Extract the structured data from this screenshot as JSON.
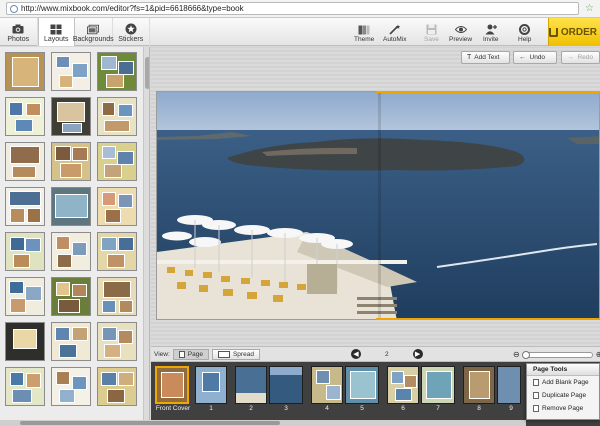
{
  "browser": {
    "url": "http://www.mixbook.com/editor?fs=1&pid=6618666&type=book"
  },
  "left_tabs": [
    {
      "label": "Photos",
      "icon": "camera-icon"
    },
    {
      "label": "Layouts",
      "icon": "grid-icon"
    },
    {
      "label": "Backgrounds",
      "icon": "background-icon"
    },
    {
      "label": "Stickers",
      "icon": "star-icon"
    }
  ],
  "toolbar": {
    "theme": "Theme",
    "automix": "AutoMix",
    "save": "Save",
    "preview": "Preview",
    "invite": "Invite",
    "help": "Help",
    "order": "ORDER"
  },
  "actions": {
    "add_text": "Add Text",
    "undo": "Undo",
    "redo": "Redo"
  },
  "view_bar": {
    "view_label": "View:",
    "page_btn": "Page",
    "spread_btn": "Spread",
    "current_page": "2"
  },
  "filmstrip": {
    "labels": [
      "Front Cover",
      "1",
      "2",
      "3",
      "4",
      "5",
      "6",
      "7",
      "8",
      "9"
    ]
  },
  "page_tools": {
    "title": "Page Tools",
    "items": [
      "Add Blank Page",
      "Duplicate Page",
      "Remove Page"
    ]
  },
  "colors": {
    "accent_orange": "#f0a500",
    "order_yellow": "#f5cc10"
  }
}
